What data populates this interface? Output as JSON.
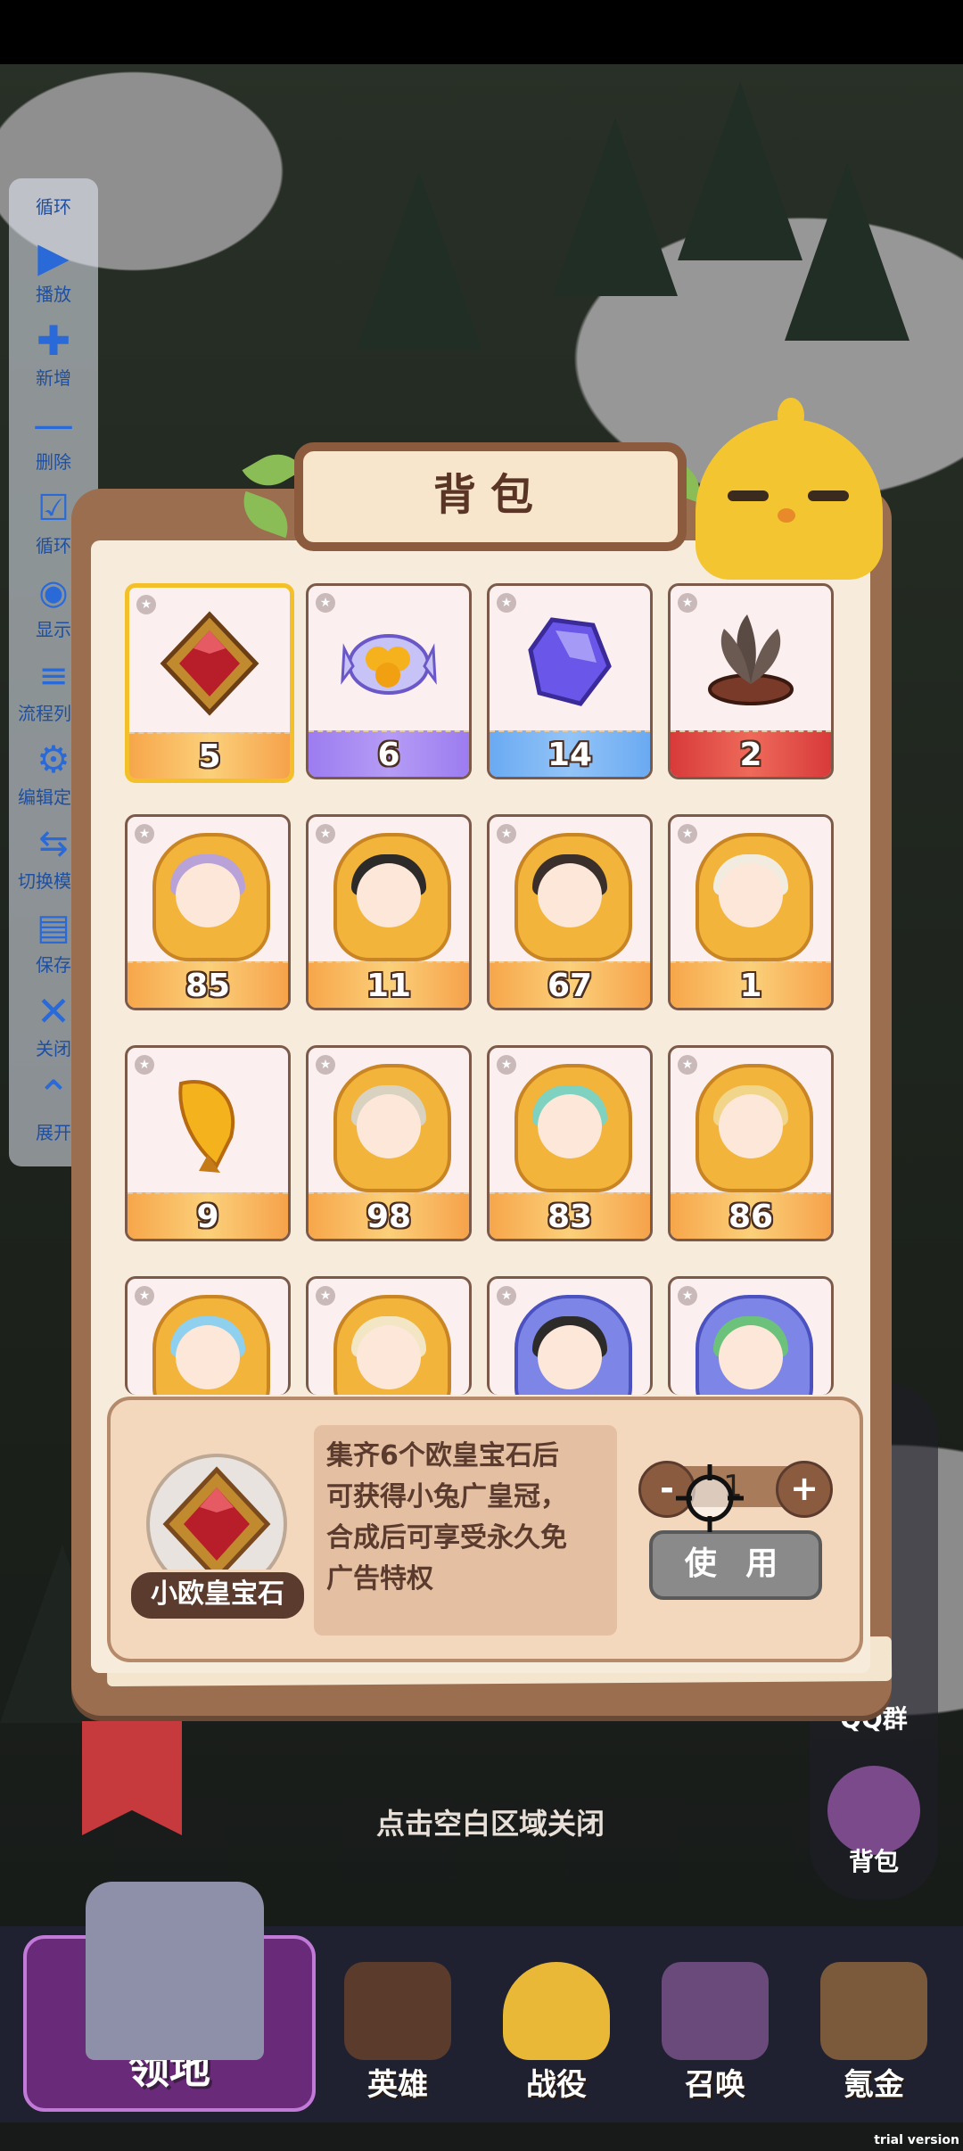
{
  "panel": {
    "title": "背包",
    "hint": "点击空白区域关闭"
  },
  "side_tools": [
    {
      "label": "循环",
      "icon": "loop-text"
    },
    {
      "label": "播放",
      "icon": "play-icon"
    },
    {
      "label": "新增",
      "icon": "plus-icon"
    },
    {
      "label": "删除",
      "icon": "minus-icon"
    },
    {
      "label": "循环",
      "icon": "checkbox-icon"
    },
    {
      "label": "显示",
      "icon": "eye-icon"
    },
    {
      "label": "流程列表",
      "icon": "list-icon"
    },
    {
      "label": "编辑定时",
      "icon": "gear-icon"
    },
    {
      "label": "切换模式",
      "icon": "switch-icon"
    },
    {
      "label": "保存",
      "icon": "save-icon"
    },
    {
      "label": "关闭",
      "icon": "close-icon"
    },
    {
      "label": "展开",
      "icon": "chevron-up-icon"
    }
  ],
  "items": [
    {
      "count": "5",
      "kind": "red-gem",
      "bar": "orange",
      "selected": true
    },
    {
      "count": "6",
      "kind": "candy",
      "bar": "purple"
    },
    {
      "count": "14",
      "kind": "purple-crystal",
      "bar": "blue"
    },
    {
      "count": "2",
      "kind": "feather-nest",
      "bar": "red"
    },
    {
      "count": "85",
      "kind": "hero-shard",
      "bar": "orange"
    },
    {
      "count": "11",
      "kind": "hero-shard",
      "bar": "orange"
    },
    {
      "count": "67",
      "kind": "hero-shard",
      "bar": "orange"
    },
    {
      "count": "1",
      "kind": "hero-shard",
      "bar": "orange"
    },
    {
      "count": "9",
      "kind": "gold-feather",
      "bar": "orange"
    },
    {
      "count": "98",
      "kind": "hero-shard",
      "bar": "orange"
    },
    {
      "count": "83",
      "kind": "hero-shard",
      "bar": "orange"
    },
    {
      "count": "86",
      "kind": "hero-shard",
      "bar": "orange"
    },
    {
      "count": "",
      "kind": "hero-shard",
      "bar": "orange"
    },
    {
      "count": "",
      "kind": "hero-shard",
      "bar": "orange"
    },
    {
      "count": "",
      "kind": "hero-shard-blue",
      "bar": "blue"
    },
    {
      "count": "",
      "kind": "hero-shard-blue",
      "bar": "blue"
    }
  ],
  "detail": {
    "name": "小欧皇宝石",
    "description_lines": [
      "集齐6个欧皇宝石后",
      "可获得小兔广皇冠，",
      "合成后可享受永久免",
      "广告特权"
    ],
    "minus": "-",
    "plus": "+",
    "quantity": "1",
    "use_label": "使 用"
  },
  "right_panel": {
    "qq_label": "QQ群",
    "bag_label": "背包"
  },
  "bottom_nav": [
    {
      "label": "领地"
    },
    {
      "label": "英雄"
    },
    {
      "label": "战役"
    },
    {
      "label": "召唤"
    },
    {
      "label": "氪金"
    }
  ],
  "watermark": "trial version",
  "colors": {
    "panel_brown": "#9a6e4f",
    "paper": "#f7ecdc",
    "selected_border": "#f4c02a",
    "tool_blue": "#2a6ad8"
  }
}
